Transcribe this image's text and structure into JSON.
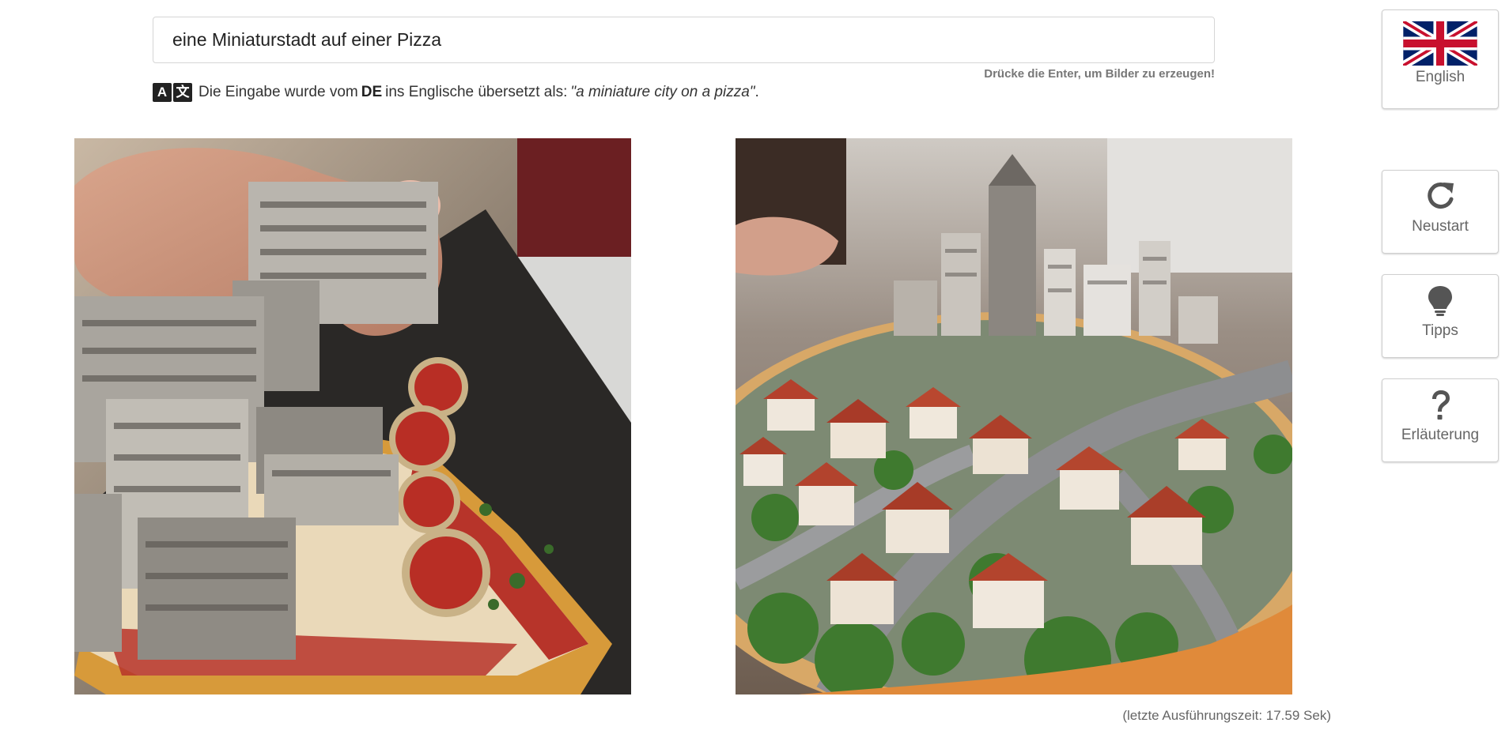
{
  "prompt": {
    "value": "eine Miniaturstadt auf einer Pizza",
    "enter_hint": "Drücke die Enter, um Bilder zu erzeugen!"
  },
  "translation": {
    "prefix": "Die Eingabe wurde vom",
    "lang": "DE",
    "middle": "ins Englische übersetzt als:",
    "translated": "\"a miniature city on a pizza\"",
    "suffix": "."
  },
  "images": [
    {
      "name": "miniature city on pizza slice with hand"
    },
    {
      "name": "miniature town on pizza"
    }
  ],
  "exec_time": "(letzte Ausführungszeit: 17.59 Sek)",
  "sidebar": {
    "language_label": "English",
    "restart_label": "Neustart",
    "tips_label": "Tipps",
    "help_label": "Erläuterung"
  },
  "icons": {
    "language": "uk-flag-icon",
    "restart": "refresh-icon",
    "tips": "lightbulb-icon",
    "help": "question-mark-icon",
    "translate": "translate-icon"
  },
  "colors": {
    "flag_blue": "#012169",
    "flag_red": "#C8102E"
  }
}
